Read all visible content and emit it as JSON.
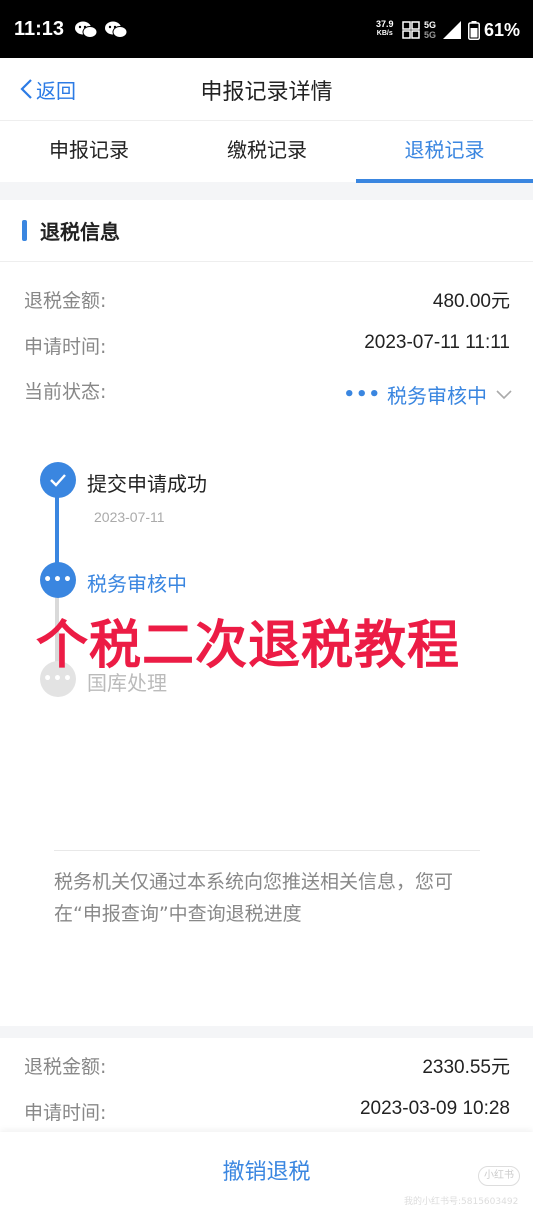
{
  "status_bar": {
    "time": "11:13",
    "net_speed_value": "37.9",
    "net_speed_unit": "KB/s",
    "network_top": "5G",
    "network_bottom": "5G",
    "battery": "61%"
  },
  "nav": {
    "back_label": "返回",
    "title": "申报记录详情"
  },
  "tabs": [
    {
      "label": "申报记录",
      "active": false
    },
    {
      "label": "缴税记录",
      "active": false
    },
    {
      "label": "退税记录",
      "active": true
    }
  ],
  "refund": {
    "section_title": "退税信息",
    "amount_label": "退税金额:",
    "amount_value": "480.00元",
    "time_label": "申请时间:",
    "time_value": "2023-07-11 11:11",
    "status_label": "当前状态:",
    "status_value": "税务审核中"
  },
  "timeline": [
    {
      "label": "提交申请成功",
      "date": "2023-07-11",
      "state": "done"
    },
    {
      "label": "税务审核中",
      "date": "",
      "state": "current"
    },
    {
      "label": "国库处理",
      "date": "",
      "state": "pending"
    }
  ],
  "overlay_caption": "个税二次退税教程",
  "notice": "税务机关仅通过本系统向您推送相关信息，您可在“申报查询”中查询退税进度",
  "second_record": {
    "amount_label": "退税金额:",
    "amount_value": "2330.55元",
    "time_label": "申请时间:",
    "time_value": "2023-03-09 10:28"
  },
  "bottom_button": "撤销退税",
  "watermark": {
    "logo": "小红书",
    "id": "我的小红书号:5815603492"
  },
  "colors": {
    "accent": "#3a86e0",
    "overlay_red": "#ec1c45",
    "muted_text": "#888888"
  }
}
